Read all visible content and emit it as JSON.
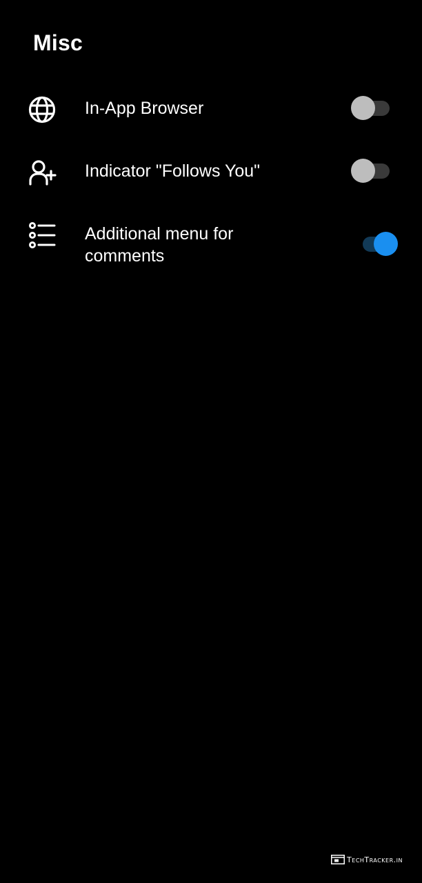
{
  "section": {
    "title": "Misc"
  },
  "settings": [
    {
      "label": "In-App Browser",
      "icon": "globe-icon",
      "enabled": false
    },
    {
      "label": "Indicator \"Follows You\"",
      "icon": "user-plus-icon",
      "enabled": false
    },
    {
      "label": "Additional menu for comments",
      "icon": "list-icon",
      "enabled": true
    }
  ],
  "colors": {
    "background": "#000000",
    "text": "#ffffff",
    "toggle_off_thumb": "#bdbdbd",
    "toggle_off_track": "#3a3a3a",
    "toggle_on_thumb": "#1a8ff0",
    "toggle_on_track": "#123a57"
  },
  "watermark": {
    "text": "TechTracker.in",
    "icon": "browser-window-icon"
  }
}
